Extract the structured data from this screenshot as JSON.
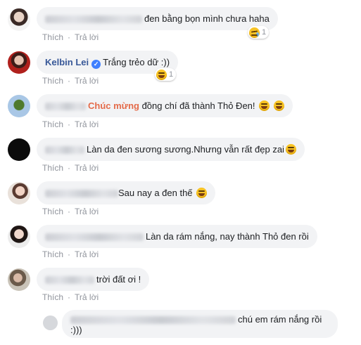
{
  "actions": {
    "like": "Thích",
    "reply": "Trả lời",
    "separator": "·"
  },
  "comments": [
    {
      "text": "đen bằng bọn mình chưa haha",
      "reaction_count": "1"
    },
    {
      "name": "Kelbin Lei",
      "verified_mark": "✓",
      "text": "Trắng trẻo dữ :))",
      "reaction_count": "1"
    },
    {
      "highlight": "Chúc mừng",
      "text": " đồng chí đã thành Thỏ Đen! "
    },
    {
      "text": "Làn da đen sương sương.Nhưng vẫn rất đẹp zai"
    },
    {
      "text": "Sau nay a đen thế "
    },
    {
      "text": "Làn da rám nắng, nay thành Thỏ đen rồi"
    },
    {
      "text": "trời đất ơi !"
    }
  ],
  "reply": {
    "line1": "chú em rám nắng rồi",
    "line2": ":)))"
  },
  "colors": {
    "bubble": "#f2f3f5",
    "name_link": "#385898",
    "highlight": "#e46b4a",
    "meta": "#90949c"
  }
}
